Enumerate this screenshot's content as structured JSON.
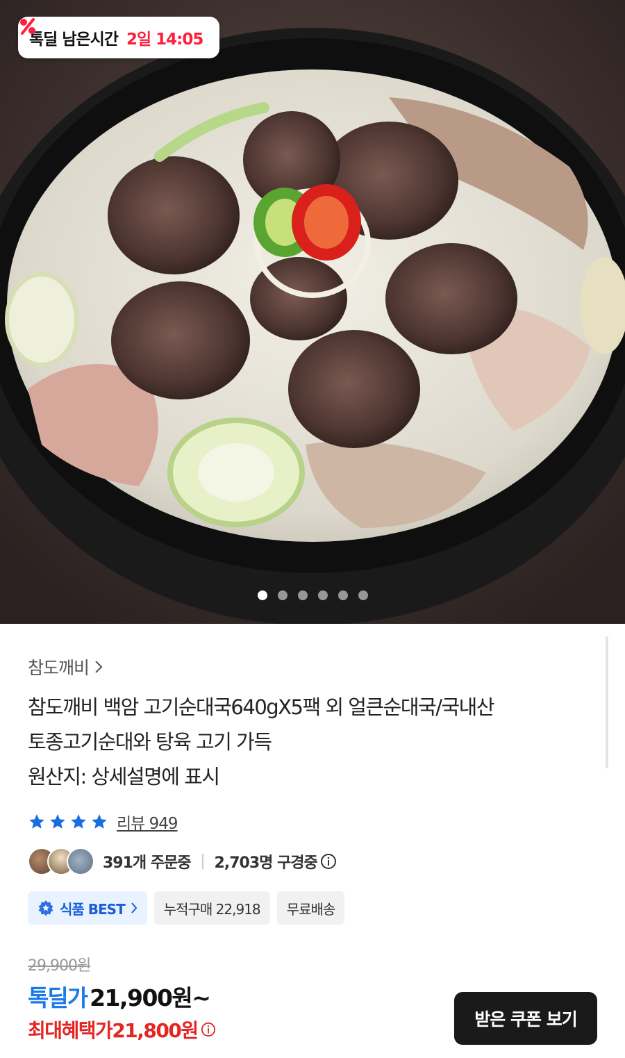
{
  "hero": {
    "timer_label": "톡딜 남은시간",
    "timer_value": "2일 14:05",
    "carousel_total": 6,
    "carousel_active": 1
  },
  "product": {
    "brand": "참도깨비",
    "title_lines": [
      "참도깨비 백암 고기순대국640gX5팩 외 얼큰순대국/국내산",
      "토종고기순대와 탕육 고기 가득",
      "원산지: 상세설명에 표시"
    ],
    "rating_stars": 4,
    "review_label": "리뷰 949",
    "orders": "391개 주문중",
    "browsing": "2,703명 구경중"
  },
  "chips": {
    "best": "식품 BEST",
    "cumulative": "누적구매 22,918",
    "shipping": "무료배송"
  },
  "price": {
    "original": "29,900원",
    "deal_label": "톡딜가",
    "deal_price": "21,900원~",
    "max_label": "최대혜택가",
    "max_price": "21,800원",
    "coupon_button": "받은 쿠폰 보기"
  },
  "colors": {
    "deal_blue": "#1a7ae8",
    "max_red": "#e52521",
    "timer_red": "#ff1e3c",
    "star_blue": "#1a6fe0"
  }
}
